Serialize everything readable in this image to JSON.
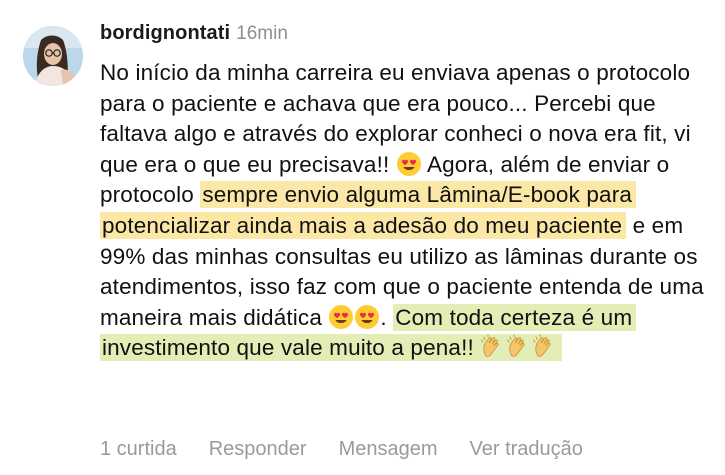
{
  "comment": {
    "username": "bordignontati",
    "timestamp": "16min",
    "text": {
      "part1": "No início da minha carreira eu enviava apenas o protocolo para o paciente e achava que era pouco... Percebi que faltava algo e através do explorar conheci o nova era fit, vi que era o que eu precisava!! ",
      "part2": " Agora, além de enviar o protocolo ",
      "highlight1": "sempre envio alguma Lâmina/E-book para potencializar ainda mais a adesão do meu paciente",
      "part3": " e em 99% das minhas consultas eu utilizo as lâminas durante os atendimentos, isso faz com que o paciente entenda de uma maneira mais didática ",
      "part4": ". ",
      "highlight2": "Com toda certeza é um investimento que vale muito a pena!! "
    },
    "emojis": {
      "heart_eyes": "smiling-face-with-heart-eyes",
      "clap": "clapping-hands"
    },
    "actions": {
      "likes": "1 curtida",
      "reply": "Responder",
      "message": "Mensagem",
      "translate": "Ver tradução"
    },
    "colors": {
      "highlight_yellow": "#fbe7a6",
      "highlight_green": "#e3edb6",
      "muted_text": "#8e8e8e"
    }
  }
}
